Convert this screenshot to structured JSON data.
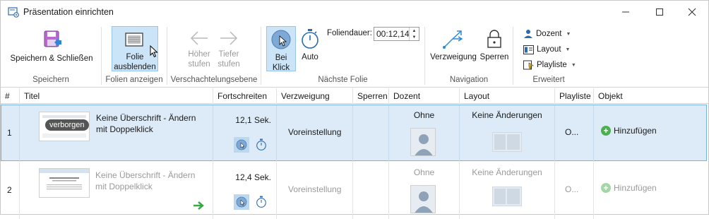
{
  "window": {
    "title": "Präsentation einrichten",
    "minimize_glyph": "—",
    "maximize_glyph": "☐",
    "close_glyph": "✕"
  },
  "ribbon": {
    "groups": {
      "speichern": {
        "label": "Speichern",
        "save_close": "Speichern & Schließen"
      },
      "folien_anzeigen": {
        "label": "Folien anzeigen",
        "hide_slide_line1": "Folie",
        "hide_slide_line2": "ausblenden"
      },
      "verschachtelung": {
        "label": "Verschachtelungsebene",
        "up_line1": "Höher",
        "up_line2": "stufen",
        "down_line1": "Tiefer",
        "down_line2": "stufen"
      },
      "naechste_folie": {
        "label": "Nächste Folie",
        "on_click_line1": "Bei",
        "on_click_line2": "Klick",
        "auto": "Auto",
        "duration_label": "Foliendauer:",
        "duration_value": "00:12,14"
      },
      "navigation": {
        "label": "Navigation",
        "branching": "Verzweigung",
        "lock": "Sperren"
      },
      "erweitert": {
        "label": "Erweitert",
        "presenter": "Dozent",
        "layout": "Layout",
        "playlist": "Playliste"
      }
    }
  },
  "table": {
    "headers": {
      "num": "#",
      "title": "Titel",
      "progress": "Fortschreiten",
      "branching": "Verzweigung",
      "lock": "Sperren",
      "presenter": "Dozent",
      "layout": "Layout",
      "playlist": "Playliste",
      "object": "Objekt"
    },
    "rows": [
      {
        "num": "1",
        "badge": "verborgen",
        "title": "Keine Überschrift - Ändern mit Doppelklick",
        "duration": "12,1 Sek.",
        "branching": "Voreinstellung",
        "presenter": "Ohne",
        "layout": "Keine Änderungen",
        "playlist": "O...",
        "object": "Hinzufügen"
      },
      {
        "num": "2",
        "title": "Keine Überschrift - Ändern mit Doppelklick",
        "duration": "12,4 Sek.",
        "branching": "Voreinstellung",
        "presenter": "Ohne",
        "layout": "Keine Änderungen",
        "playlist": "O...",
        "object": "Hinzufügen"
      }
    ]
  },
  "colors": {
    "accent": "#2b88d8",
    "selected_row": "#dcebf7",
    "active_button": "#cce4f7",
    "add_green": "#4caf50",
    "arrow_green": "#3aa845"
  }
}
